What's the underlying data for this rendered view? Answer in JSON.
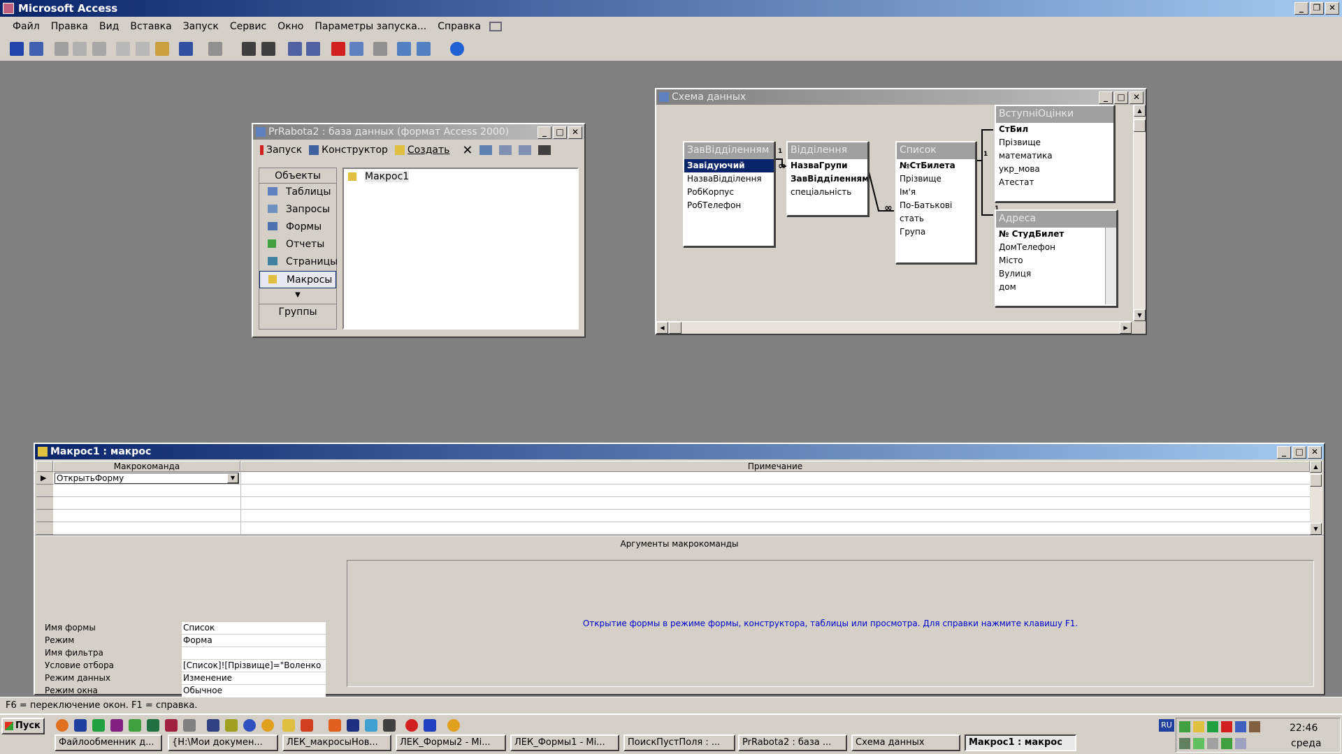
{
  "app": {
    "title": "Microsoft Access"
  },
  "menu": [
    "Файл",
    "Правка",
    "Вид",
    "Вставка",
    "Запуск",
    "Сервис",
    "Окно",
    "Параметры запуска...",
    "Справка"
  ],
  "dbwin": {
    "title": "PrRabota2 : база данных (формат Access 2000)",
    "toolbar": {
      "run": "Запуск",
      "design": "Конструктор",
      "create": "Создать"
    },
    "objects_header": "Объекты",
    "objects": [
      "Таблицы",
      "Запросы",
      "Формы",
      "Отчеты",
      "Страницы",
      "Макросы"
    ],
    "groups": "Группы",
    "items": [
      "Макрос1"
    ]
  },
  "schema": {
    "title": "Схема данных",
    "tables": [
      {
        "name": "ЗавВідділенням",
        "fields": [
          "Завідуючий",
          "НазваВідділення",
          "РобКорпус",
          "РобТелефон"
        ]
      },
      {
        "name": "Відділення",
        "fields": [
          "НазваГрупи",
          "ЗавВідділенням",
          "спеціальність"
        ]
      },
      {
        "name": "Список",
        "fields": [
          "№СтБилета",
          "Прізвище",
          "Ім'я",
          "По-Батькові",
          "стать",
          "Група"
        ]
      },
      {
        "name": "ВступніОцінки",
        "fields": [
          "СтБил",
          "Прізвище",
          "математика",
          "укр_мова",
          "Атестат"
        ]
      },
      {
        "name": "Адреса",
        "fields": [
          "№ СтудБилет",
          "ДомТелефон",
          "Місто",
          "Вулиця",
          "дом"
        ]
      }
    ],
    "rel_one": "1",
    "rel_many": "∞"
  },
  "macro": {
    "title": "Макрос1 : макрос",
    "col_action": "Макрокоманда",
    "col_note": "Примечание",
    "row1_action": "ОткрытьФорму",
    "args_header": "Аргументы макрокоманды",
    "args": [
      {
        "label": "Имя формы",
        "value": "Список"
      },
      {
        "label": "Режим",
        "value": "Форма"
      },
      {
        "label": "Имя фильтра",
        "value": ""
      },
      {
        "label": "Условие отбора",
        "value": "[Список]![Прізвище]=\"Воленко"
      },
      {
        "label": "Режим данных",
        "value": "Изменение"
      },
      {
        "label": "Режим окна",
        "value": "Обычное"
      }
    ],
    "help": "Открытие формы в режиме формы, конструктора, таблицы или просмотра. Для справки нажмите клавишу F1."
  },
  "status": "F6 = переключение окон.  F1 = справка.",
  "taskbar": {
    "start": "Пуск",
    "tasks": [
      "Файлообменник д...",
      "{H:\\Мои докумен...",
      "ЛЕК_макросыНов...",
      "ЛЕК_Формы2 - Mi...",
      "ЛЕК_Формы1 - Mi...",
      "ПоискПустПоля : ...",
      "PrRabota2 : база ...",
      "Схема данных",
      "Макрос1 : макрос"
    ],
    "lang": "RU",
    "time": "22:46",
    "day": "среда"
  },
  "colors": {
    "title_active": "#0a246a",
    "face": "#d4d0c8",
    "help_text": "#0000cc"
  }
}
